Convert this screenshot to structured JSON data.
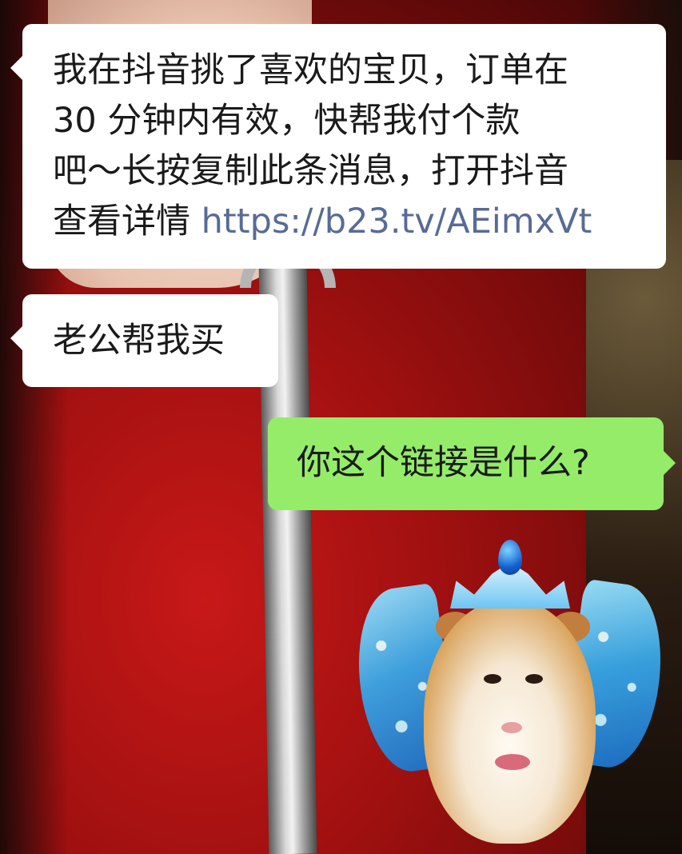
{
  "messages": [
    {
      "direction": "incoming",
      "lines": [
        "我在抖音挑了喜欢的宝贝，订单在",
        "30 分钟内有效，快帮我付个款",
        "吧～长按复制此条消息，打开抖音"
      ],
      "last_line_text": "查看详情",
      "link": "https://b23.tv/AEimxVt"
    },
    {
      "direction": "incoming",
      "text": "老公帮我买"
    },
    {
      "direction": "outgoing",
      "text": "你这个链接是什么?"
    }
  ],
  "sticker": {
    "icon": "fairy-guinea-pig-sticker-icon",
    "description_colors": {
      "wings": "#3aa8e8",
      "crown_gem": "#1460d0",
      "fur": "#d9a25a"
    }
  },
  "colors": {
    "incoming_bubble": "#ffffff",
    "outgoing_bubble": "#95ec69",
    "link": "#576b95",
    "text": "#1a1a1a"
  }
}
